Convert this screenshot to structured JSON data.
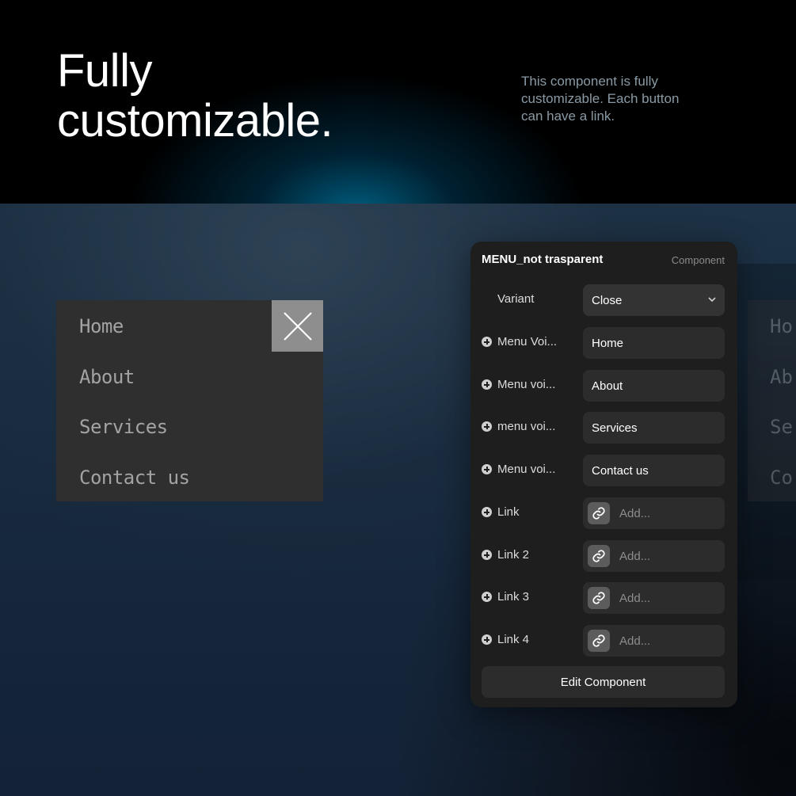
{
  "hero": {
    "title_line1": "Fully",
    "title_line2": "customizable.",
    "desc_line1": "This component is fully",
    "desc_line2": "customizable. Each button",
    "desc_line3": "can have a link."
  },
  "menu_preview": {
    "items": [
      "Home",
      "About",
      "Services",
      "Contact us"
    ],
    "close_icon": "close-icon"
  },
  "ghost_menu": {
    "items": [
      "Ho",
      "Ab",
      "Se",
      "Co"
    ]
  },
  "panel": {
    "title": "MENU_not trasparent",
    "subtitle": "Component",
    "variant": {
      "label": "Variant",
      "value": "Close"
    },
    "menu_voices": [
      {
        "label": "Menu Voi...",
        "value": "Home"
      },
      {
        "label": "Menu voi...",
        "value": "About"
      },
      {
        "label": "menu voi...",
        "value": "Services"
      },
      {
        "label": "Menu voi...",
        "value": "Contact us"
      }
    ],
    "links": [
      {
        "label": "Link",
        "placeholder": "Add..."
      },
      {
        "label": "Link 2",
        "placeholder": "Add..."
      },
      {
        "label": "Link 3",
        "placeholder": "Add..."
      },
      {
        "label": "Link 4",
        "placeholder": "Add..."
      }
    ],
    "edit_button": "Edit Component"
  }
}
